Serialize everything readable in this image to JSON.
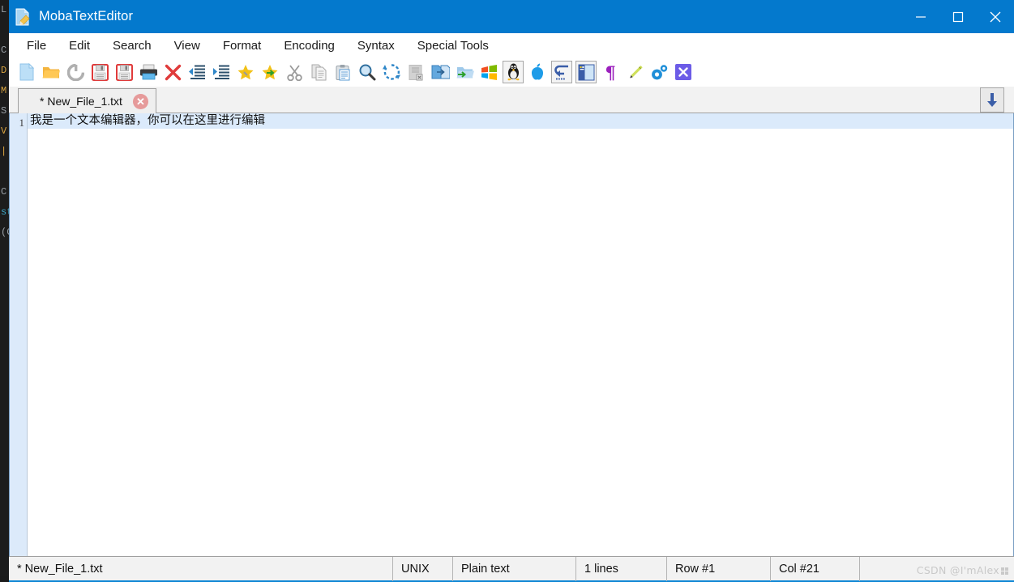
{
  "window": {
    "title": "MobaTextEditor",
    "title_icon": "document-pencil-icon",
    "controls": {
      "minimize": "minimize-icon",
      "maximize": "maximize-icon",
      "close": "close-icon"
    },
    "accent_color": "#0479cd"
  },
  "menubar": {
    "items": [
      {
        "label": "File"
      },
      {
        "label": "Edit"
      },
      {
        "label": "Search"
      },
      {
        "label": "View"
      },
      {
        "label": "Format"
      },
      {
        "label": "Encoding"
      },
      {
        "label": "Syntax"
      },
      {
        "label": "Special Tools"
      }
    ]
  },
  "toolbar": {
    "buttons": [
      {
        "name": "new-file-icon",
        "tip": "New file"
      },
      {
        "name": "open-file-icon",
        "tip": "Open file"
      },
      {
        "name": "reload-icon",
        "tip": "Reload"
      },
      {
        "name": "save-icon",
        "tip": "Save"
      },
      {
        "name": "save-as-icon",
        "tip": "Save as"
      },
      {
        "name": "print-icon",
        "tip": "Print"
      },
      {
        "name": "close-file-icon",
        "tip": "Close file"
      },
      {
        "name": "decrease-indent-icon",
        "tip": "Decrease indent"
      },
      {
        "name": "increase-indent-icon",
        "tip": "Increase indent"
      },
      {
        "name": "bookmark-add-icon",
        "tip": "Add bookmark"
      },
      {
        "name": "bookmark-next-icon",
        "tip": "Next bookmark"
      },
      {
        "name": "cut-icon",
        "tip": "Cut"
      },
      {
        "name": "copy-icon",
        "tip": "Copy"
      },
      {
        "name": "paste-icon",
        "tip": "Paste"
      },
      {
        "name": "find-icon",
        "tip": "Find"
      },
      {
        "name": "replace-icon",
        "tip": "Replace"
      },
      {
        "name": "close-document-icon",
        "tip": "Close document"
      },
      {
        "name": "compare-files-icon",
        "tip": "Compare files"
      },
      {
        "name": "send-to-folder-icon",
        "tip": "Send to folder"
      },
      {
        "name": "windows-format-icon",
        "tip": "Windows format"
      },
      {
        "name": "linux-format-icon",
        "tip": "Unix format",
        "state": "selected"
      },
      {
        "name": "mac-format-icon",
        "tip": "Mac format"
      },
      {
        "name": "word-wrap-icon",
        "tip": "Word wrap",
        "state": "framed"
      },
      {
        "name": "side-panel-icon",
        "tip": "Side panel",
        "state": "framed"
      },
      {
        "name": "pilcrow-icon",
        "tip": "Show special characters"
      },
      {
        "name": "highlighter-icon",
        "tip": "Highlight"
      },
      {
        "name": "settings-icon",
        "tip": "Settings"
      },
      {
        "name": "exit-icon",
        "tip": "Exit"
      }
    ]
  },
  "tabs": {
    "items": [
      {
        "label": "* New_File_1.txt",
        "close_icon": "tab-close-icon",
        "active": true
      }
    ],
    "scroll_down_icon": "arrow-down-icon"
  },
  "editor": {
    "lines": [
      {
        "number": "1",
        "text": "我是一个文本编辑器，你可以在这里进行编辑",
        "current": true
      }
    ],
    "current_line_color": "#dbeafb",
    "gutter_color": "#dceafa"
  },
  "statusbar": {
    "file": "* New_File_1.txt",
    "eol": "UNIX",
    "filetype": "Plain text",
    "lines": "1 lines",
    "row": "Row #1",
    "col": "Col #21",
    "watermark": "CSDN @I'mAlex"
  },
  "backdrop": {
    "strip_lines": [
      "L",
      "M",
      "S",
      "V",
      "|",
      "",
      "C",
      "st",
      "(C"
    ]
  }
}
